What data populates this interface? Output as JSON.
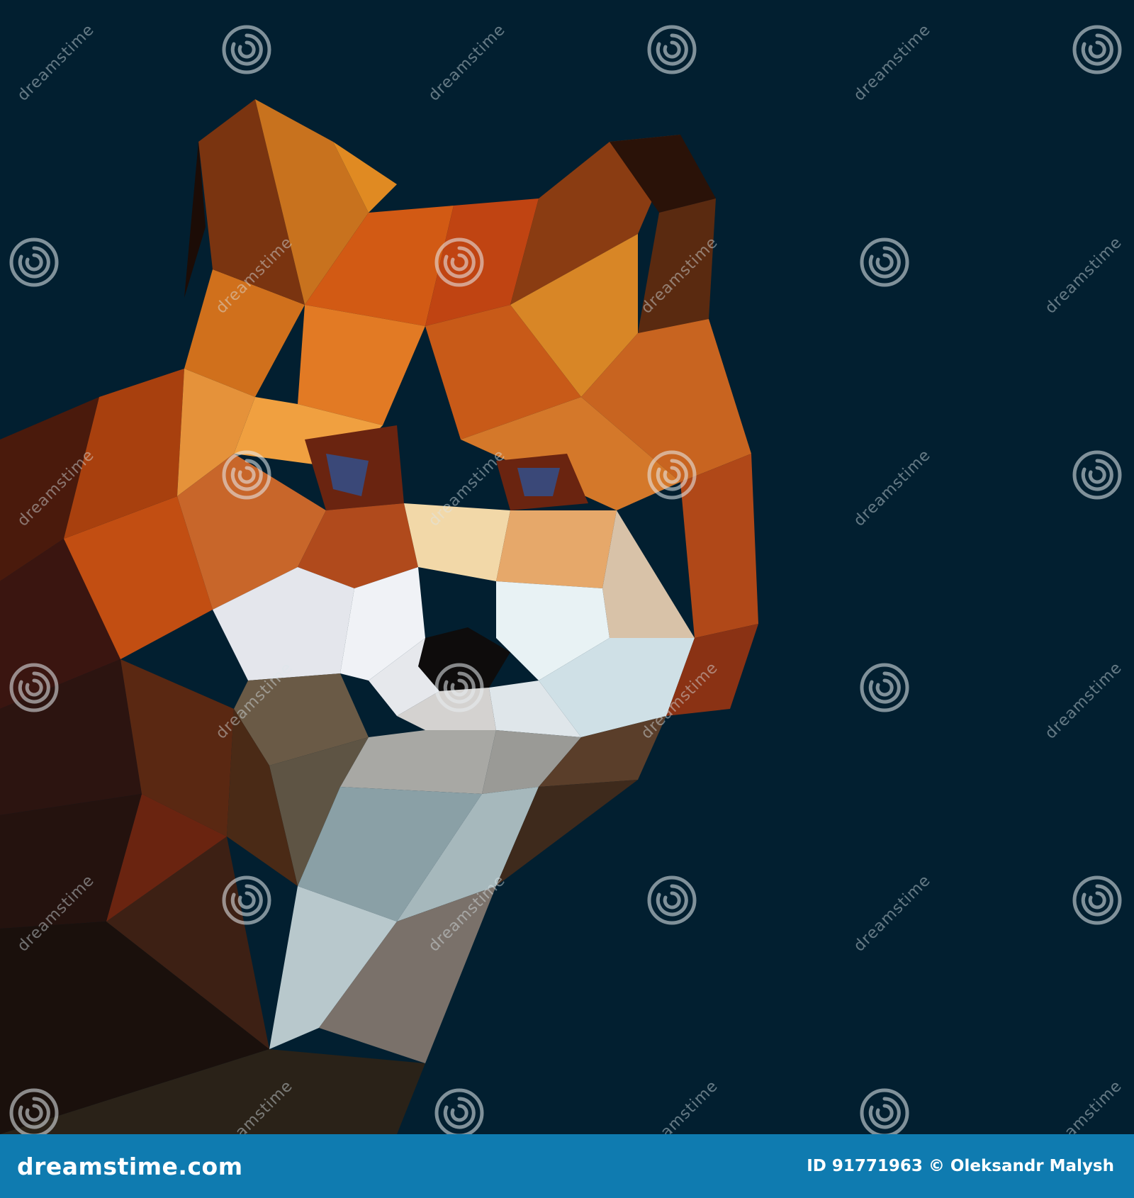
{
  "image": {
    "background_color": "#021f30",
    "footer_color": "#0f7bb0"
  },
  "watermark": {
    "text": "dreamstime",
    "icon": "spiral-icon"
  },
  "footer": {
    "brand": "dreamstime.com",
    "credit": "ID 91771963 © Oleksandr Malysh"
  }
}
